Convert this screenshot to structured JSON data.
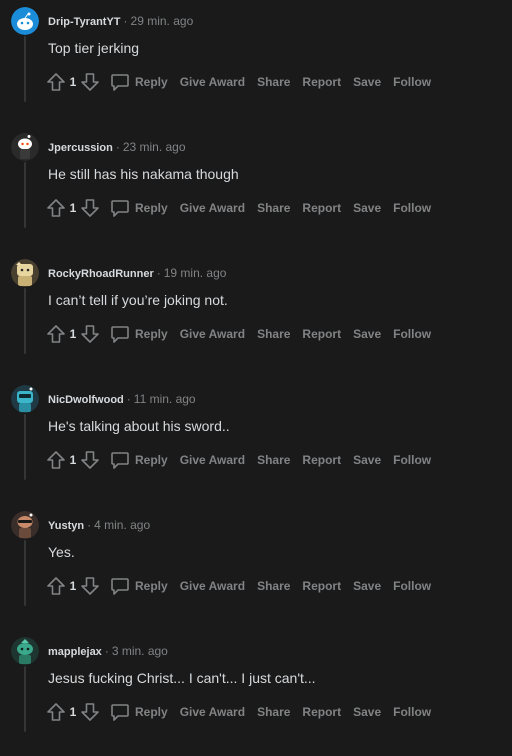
{
  "actions": {
    "reply": "Reply",
    "give_award": "Give Award",
    "share": "Share",
    "report": "Report",
    "save": "Save",
    "follow": "Follow"
  },
  "comments": [
    {
      "username": "Drip-TyrantYT",
      "time": "29 min. ago",
      "body": "Top tier jerking",
      "score": "1",
      "avatar_color": "#1a8cd8"
    },
    {
      "username": "Jpercussion",
      "time": "23 min. ago",
      "body": "He still has his nakama though",
      "score": "1",
      "avatar_color": "#ffffff"
    },
    {
      "username": "RockyRhoadRunner",
      "time": "19 min. ago",
      "body": "I can’t tell if you’re joking not.",
      "score": "1",
      "avatar_color": "#e8d6a0"
    },
    {
      "username": "NicDwolfwood",
      "time": "11 min. ago",
      "body": "He's talking about his sword..",
      "score": "1",
      "avatar_color": "#3ab5c9"
    },
    {
      "username": "Yustyn",
      "time": "4 min. ago",
      "body": "Yes.",
      "score": "1",
      "avatar_color": "#c98a6a"
    },
    {
      "username": "mapplejax",
      "time": "3 min. ago",
      "body": "Jesus fucking Christ... I can't... I just can't...",
      "score": "1",
      "avatar_color": "#3aa88a"
    }
  ]
}
